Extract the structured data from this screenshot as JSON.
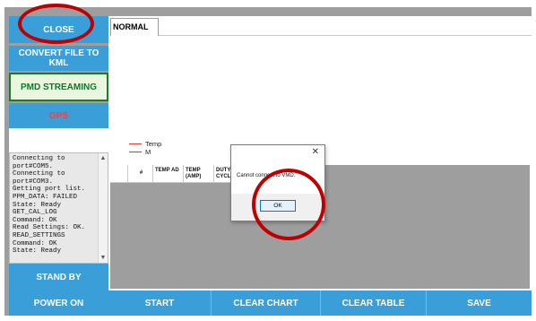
{
  "sidebar": {
    "close_label": "CLOSE",
    "convert_label": "CONVERT FILE TO KML",
    "pmd_label": "PMD STREAMING",
    "gps_label": "GPS",
    "standby_label": "STAND BY",
    "power_label": "POWER ON"
  },
  "log_text": "Connecting to\nport#COM5.\nConnecting to\nport#COM3.\nGetting port list.\nPPM_DATA: FAILED\nState: Ready\nGET_CAL_LOG\nCommand: OK\nRead Settings: OK.\nREAD_SETTINGS\nCommand: OK\nState: Ready",
  "tab": {
    "label": "NORMAL"
  },
  "legend": {
    "items": [
      {
        "label": "Temp",
        "color": "#e53935"
      },
      {
        "label": "M",
        "color": "#3b5fe0"
      }
    ]
  },
  "table": {
    "columns": [
      "#",
      "TEMP AD",
      "TEMP (AMP)",
      "DUTY CYCL"
    ]
  },
  "dialog": {
    "close_glyph": "✕",
    "message": "Cannot connect to VMD.",
    "ok_label": "OK"
  },
  "bottom": {
    "start_label": "START",
    "clear_chart_label": "CLEAR CHART",
    "clear_table_label": "CLEAR TABLE",
    "save_label": "SAVE"
  },
  "annotation": {
    "color": "#c00000"
  }
}
